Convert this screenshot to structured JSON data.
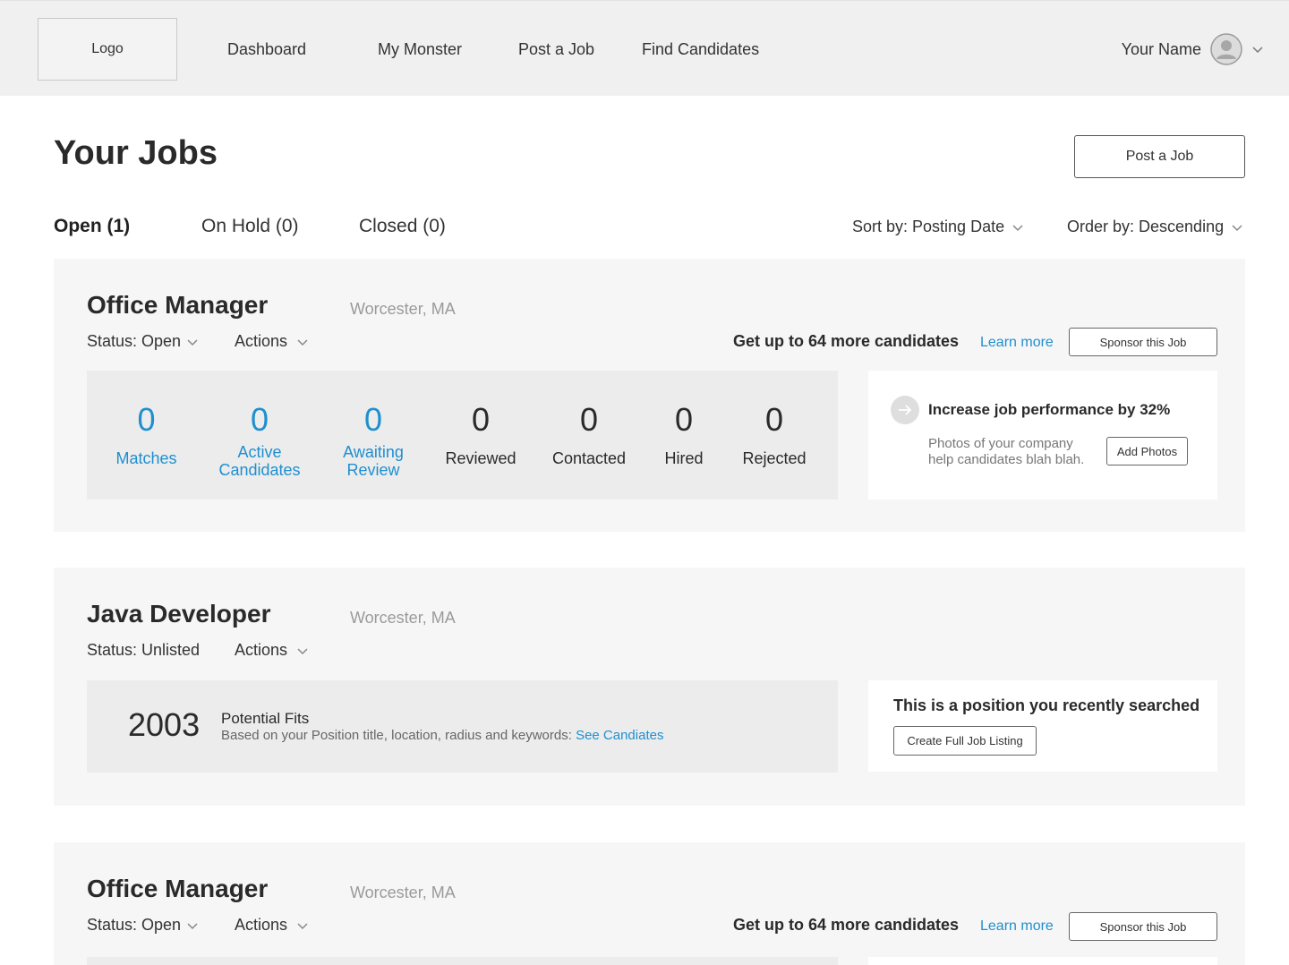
{
  "header": {
    "logo": "Logo",
    "nav": [
      "Dashboard",
      "My Monster",
      "Post a Job",
      "Find Candidates"
    ],
    "user_name": "Your Name"
  },
  "page": {
    "title": "Your Jobs",
    "post_button": "Post a Job"
  },
  "tabs": [
    {
      "label": "Open (1)",
      "active": true
    },
    {
      "label": "On Hold (0)",
      "active": false
    },
    {
      "label": "Closed (0)",
      "active": false
    }
  ],
  "sort": {
    "sort_label": "Sort by: Posting Date",
    "order_label": "Order by: Descending"
  },
  "jobs": [
    {
      "title": "Office Manager",
      "location": "Worcester, MA",
      "status": "Status: Open",
      "actions": "Actions",
      "promo": "Get up to 64 more candidates",
      "learn_more": "Learn more",
      "sponsor": "Sponsor this Job",
      "stats": [
        {
          "value": "0",
          "label": "Matches"
        },
        {
          "value": "0",
          "label": "Active Candidates"
        },
        {
          "value": "0",
          "label": "Awaiting Review"
        },
        {
          "value": "0",
          "label": "Reviewed"
        },
        {
          "value": "0",
          "label": "Contacted"
        },
        {
          "value": "0",
          "label": "Hired"
        },
        {
          "value": "0",
          "label": "Rejected"
        }
      ],
      "tip": {
        "title": "Increase job performance by 32%",
        "body_line1": "Photos of your company",
        "body_line2": "help candidates blah blah.",
        "button": "Add Photos"
      }
    },
    {
      "title": "Java Developer",
      "location": "Worcester, MA",
      "status": "Status: Unlisted",
      "actions": "Actions",
      "fits_count": "2003",
      "fits_title": "Potential Fits",
      "fits_desc": "Based on your Position title, location, radius and keywords:",
      "fits_link": "See Candiates",
      "side_title": "This is a position you recently searched",
      "side_button": "Create Full Job Listing"
    },
    {
      "title": "Office Manager",
      "location": "Worcester, MA",
      "status": "Status: Open",
      "actions": "Actions",
      "promo": "Get up to 64 more candidates",
      "learn_more": "Learn more",
      "sponsor": "Sponsor this Job"
    }
  ],
  "colors": {
    "link": "#1f8fcf",
    "header_bg": "#f0f0f1",
    "card_bg": "#f6f6f6",
    "stats_bg": "#ececec"
  }
}
